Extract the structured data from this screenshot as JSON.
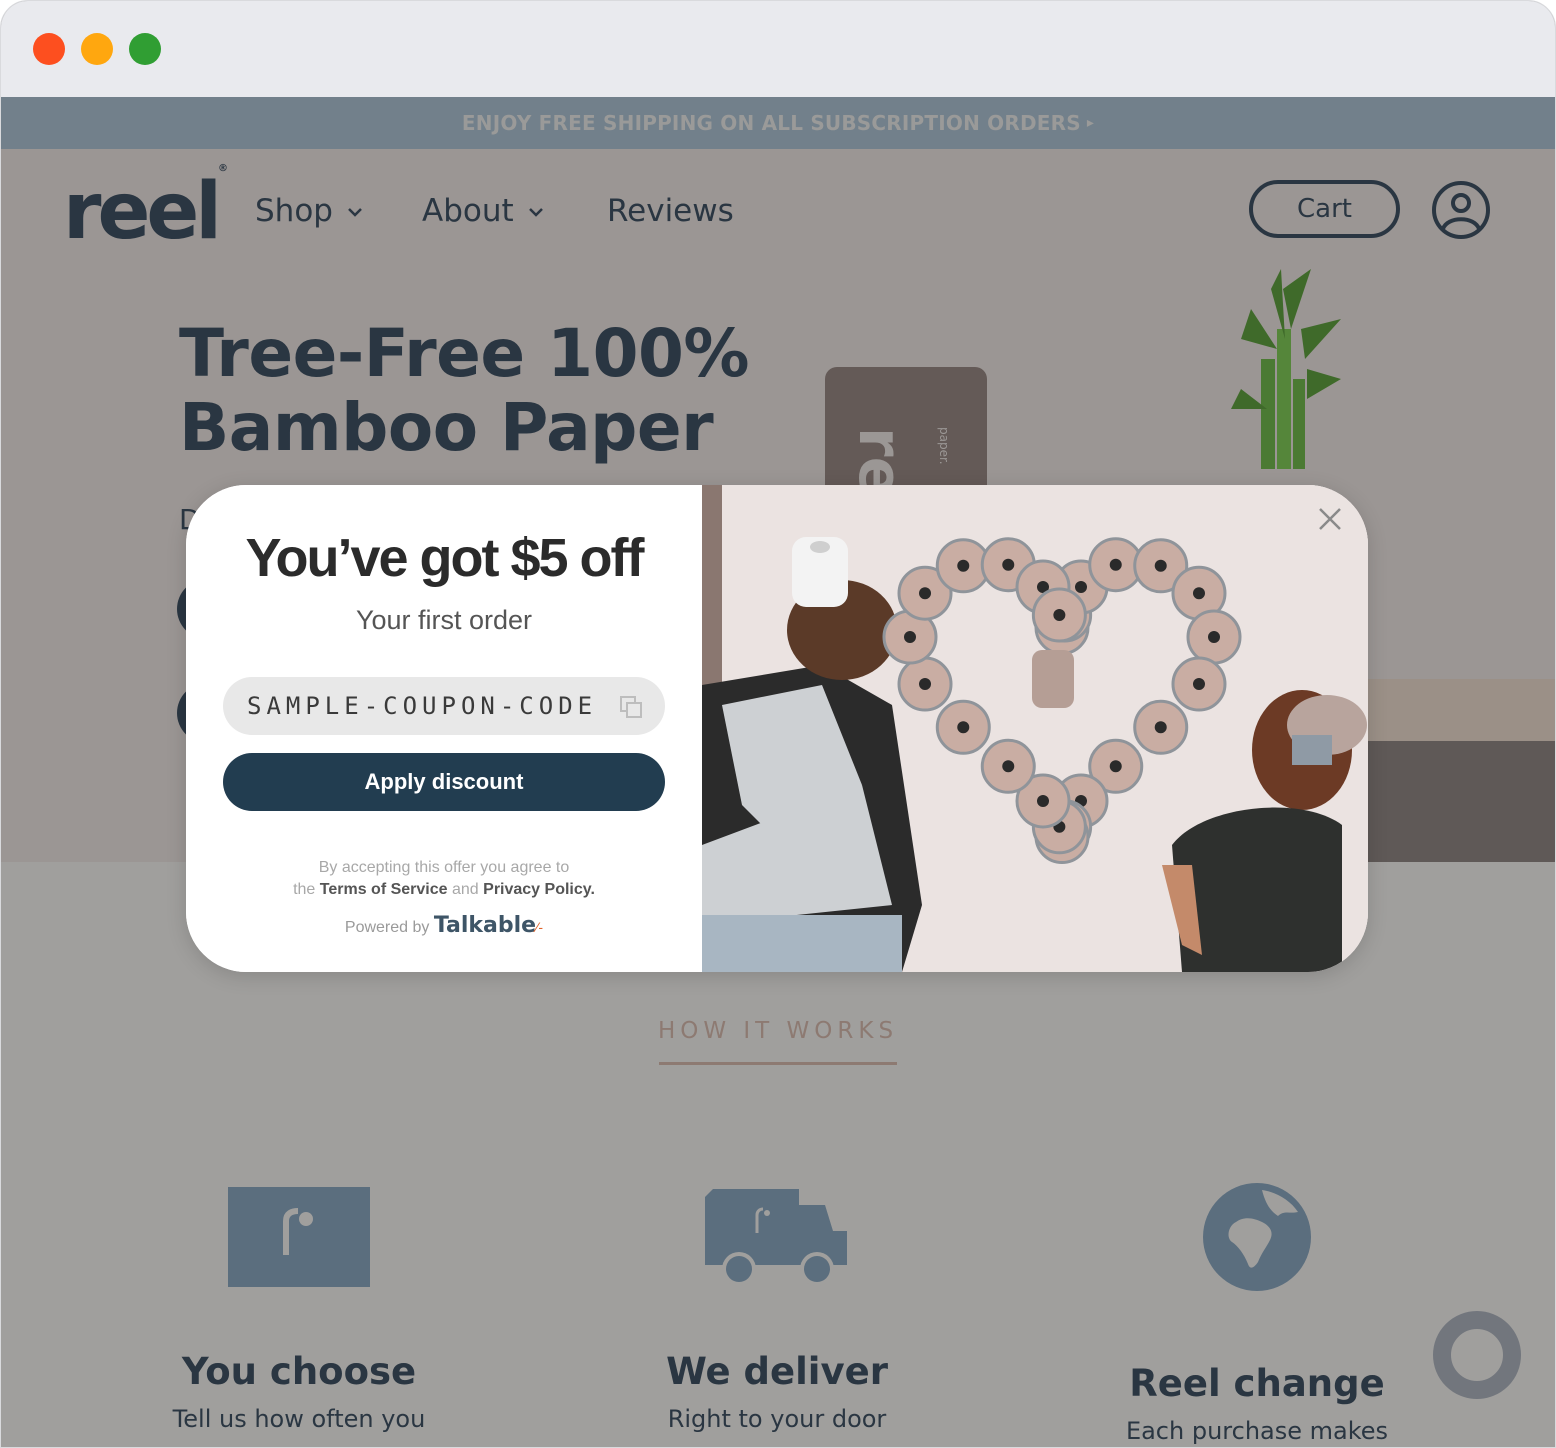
{
  "window": {
    "controls": [
      "close",
      "minimize",
      "maximize"
    ],
    "colors": {
      "close": "#fd4f1f",
      "minimize": "#ffa70f",
      "maximize": "#309e33"
    }
  },
  "promo_bar": {
    "text": "ENJOY FREE SHIPPING ON ALL SUBSCRIPTION ORDERS",
    "caret": "▸"
  },
  "nav": {
    "logo": "reel",
    "logo_mark": "®",
    "items": [
      {
        "label": "Shop",
        "has_dropdown": true
      },
      {
        "label": "About",
        "has_dropdown": true
      },
      {
        "label": "Reviews",
        "has_dropdown": false
      }
    ],
    "chevron": "⌄",
    "cart_label": "Cart",
    "account_icon": "user-circle-icon"
  },
  "hero": {
    "title_line1": "Tree-Free 100%",
    "title_line2": "Bamboo Paper",
    "subtitle_partial": "D",
    "product_brand": "reel",
    "product_small": "paper."
  },
  "how_it_works": {
    "title": "HOW IT WORKS",
    "steps": [
      {
        "icon": "box-icon",
        "title": "You choose",
        "desc": "Tell us how often you"
      },
      {
        "icon": "delivery-truck-icon",
        "title": "We deliver",
        "desc": "Right to your door"
      },
      {
        "icon": "globe-icon",
        "title": "Reel change",
        "desc": "Each purchase makes"
      }
    ]
  },
  "modal": {
    "headline": "You’ve got $5 off",
    "subhead": "Your first order",
    "coupon_code": "SAMPLE-COUPON-CODE",
    "apply_label": "Apply discount",
    "legal_prefix": "By accepting this offer you agree to",
    "legal_the": "the",
    "terms_label": "Terms of Service",
    "legal_and": "and",
    "privacy_label": "Privacy Policy.",
    "powered_by": "Powered by",
    "powered_brand": "Talkable",
    "close_icon": "close-icon",
    "accent_color": "#223d50"
  }
}
